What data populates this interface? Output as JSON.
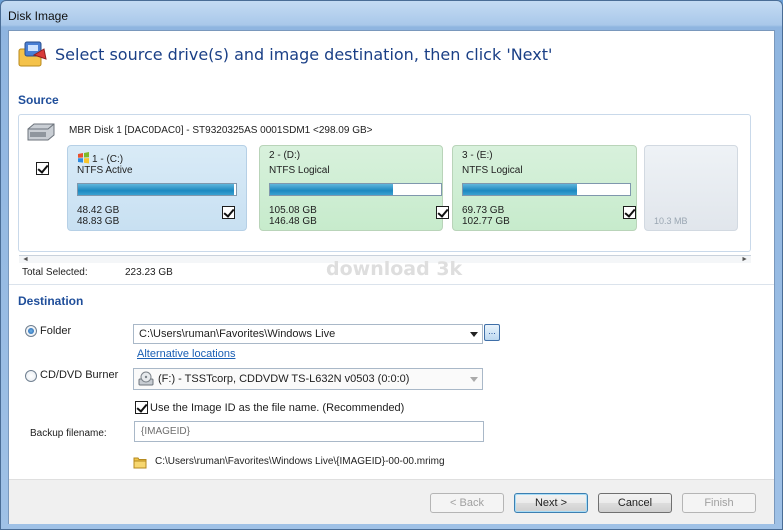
{
  "window": {
    "title": "Disk Image"
  },
  "header": {
    "text": "Select source drive(s) and image destination, then click 'Next'",
    "icon": "disk-image-wizard-icon"
  },
  "source": {
    "section_title": "Source",
    "disk_label": "MBR Disk 1 [DAC0DAC0] - ST9320325AS 0001SDM1  <298.09 GB>",
    "disk_checked": true,
    "partitions": [
      {
        "name": "1 -  (C:)",
        "type": "NTFS Active",
        "used": "48.42 GB",
        "total": "48.83 GB",
        "fill_fraction": 0.99,
        "checked": true,
        "icon": "windows-flag-icon"
      },
      {
        "name": "2 -  (D:)",
        "type": "NTFS Logical",
        "used": "105.08 GB",
        "total": "146.48 GB",
        "fill_fraction": 0.72,
        "checked": true
      },
      {
        "name": "3 -  (E:)",
        "type": "NTFS Logical",
        "used": "69.73 GB",
        "total": "102.77 GB",
        "fill_fraction": 0.68,
        "checked": true
      }
    ],
    "unallocated": {
      "size": "10.3 MB"
    },
    "total_selected_label": "Total Selected:",
    "total_selected_value": "223.23 GB"
  },
  "watermark": "download 3k",
  "destination": {
    "section_title": "Destination",
    "folder_label": "Folder",
    "folder_selected": true,
    "folder_path": "C:\\Users\\ruman\\Favorites\\Windows Live",
    "browse_label": "...",
    "alt_locations": "Alternative locations",
    "cd_label": "CD/DVD Burner",
    "cd_selected": false,
    "cd_drive": "(F:) - TSSTcorp, CDDVDW TS-L632N  v0503 (0:0:0)",
    "use_image_id_label": "Use the Image ID as the file name.  (Recommended)",
    "use_image_id_checked": true,
    "backup_filename_label": "Backup filename:",
    "backup_filename_value": "{IMAGEID}",
    "result_path": "C:\\Users\\ruman\\Favorites\\Windows Live\\{IMAGEID}-00-00.mrimg"
  },
  "footer": {
    "back": "< Back",
    "next": "Next >",
    "cancel": "Cancel",
    "finish": "Finish"
  },
  "colors": {
    "accent_title": "#1a3f86",
    "section": "#1f4e9a",
    "link": "#1a5fb4",
    "bar_fill": "#1c88c0",
    "partition_green": "#c7ebcc",
    "partition_blue": "#c8e0f2"
  }
}
